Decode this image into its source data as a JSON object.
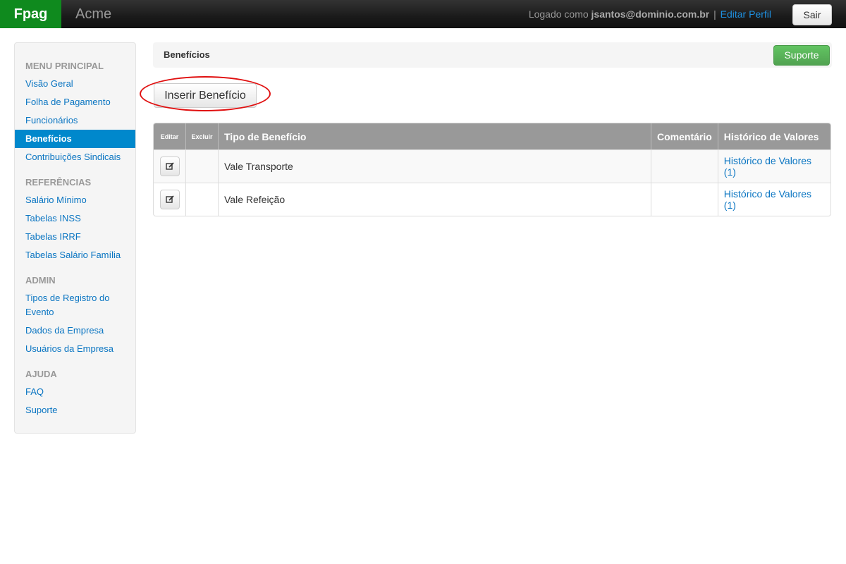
{
  "navbar": {
    "brand": "Fpag",
    "company": "Acme",
    "logged_as": "Logado como",
    "user": "jsantos@dominio.com.br",
    "separator": "|",
    "edit_profile": "Editar Perfil",
    "logout": "Sair"
  },
  "sidebar": {
    "sections": [
      {
        "title": "MENU PRINCIPAL",
        "items": [
          "Visão Geral",
          "Folha de Pagamento",
          "Funcionários",
          "Benefícios",
          "Contribuições Sindicais"
        ]
      },
      {
        "title": "REFERÊNCIAS",
        "items": [
          "Salário Mínimo",
          "Tabelas INSS",
          "Tabelas IRRF",
          "Tabelas Salário Família"
        ]
      },
      {
        "title": "ADMIN",
        "items": [
          "Tipos de Registro do Evento",
          "Dados da Empresa",
          "Usuários da Empresa"
        ]
      },
      {
        "title": "AJUDA",
        "items": [
          "FAQ",
          "Suporte"
        ]
      }
    ],
    "active_item": "Benefícios"
  },
  "page": {
    "title": "Benefícios",
    "support_button": "Suporte",
    "insert_button": "Inserir Benefício"
  },
  "table": {
    "headers": [
      "Editar",
      "Excluir",
      "Tipo de Benefício",
      "Comentário",
      "Histórico de Valores"
    ],
    "rows": [
      {
        "type": "Vale Transporte",
        "comment": "",
        "history": "Histórico de Valores (1)"
      },
      {
        "type": "Vale Refeição",
        "comment": "",
        "history": "Histórico de Valores (1)"
      }
    ]
  },
  "colors": {
    "brand": "#0f8a1e",
    "active": "#0088cc",
    "link": "#0a75c2",
    "support": "#5bb75b",
    "highlight": "#e01010"
  },
  "icons": {
    "edit": "edit-icon"
  }
}
